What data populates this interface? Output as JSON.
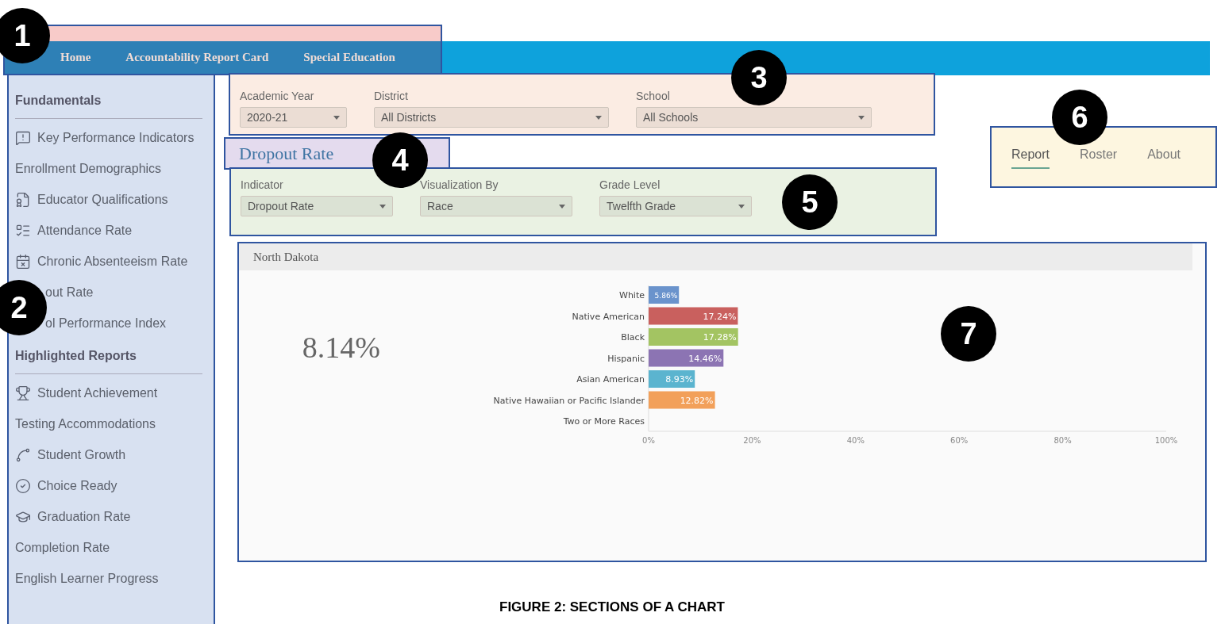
{
  "annotations": [
    {
      "label": "1"
    },
    {
      "label": "2"
    },
    {
      "label": "3"
    },
    {
      "label": "4"
    },
    {
      "label": "5"
    },
    {
      "label": "6"
    },
    {
      "label": "7"
    }
  ],
  "top_nav": {
    "items": [
      {
        "label": "Home"
      },
      {
        "label": "Accountability Report Card"
      },
      {
        "label": "Special Education"
      }
    ]
  },
  "sidebar": {
    "sections": [
      {
        "title": "Fundamentals",
        "items": [
          {
            "label": "Key Performance Indicators"
          },
          {
            "label": "Enrollment Demographics"
          },
          {
            "label": "Educator Qualifications"
          },
          {
            "label": "Attendance Rate"
          },
          {
            "label": "Chronic Absenteeism Rate"
          },
          {
            "label": "out Rate"
          },
          {
            "label": "ol Performance Index"
          }
        ]
      },
      {
        "title": "Highlighted Reports",
        "items": [
          {
            "label": "Student Achievement"
          },
          {
            "label": "Testing Accommodations"
          },
          {
            "label": "Student Growth"
          },
          {
            "label": "Choice Ready"
          },
          {
            "label": "Graduation Rate"
          },
          {
            "label": "Completion Rate"
          },
          {
            "label": "English Learner Progress"
          }
        ]
      }
    ]
  },
  "filters": [
    {
      "label": "Academic Year",
      "value": "2020-21"
    },
    {
      "label": "District",
      "value": "All Districts"
    },
    {
      "label": "School",
      "value": "All Schools"
    }
  ],
  "page_title": "Dropout Rate",
  "report_filters": [
    {
      "label": "Indicator",
      "value": "Dropout Rate"
    },
    {
      "label": "Visualization By",
      "value": "Race"
    },
    {
      "label": "Grade Level",
      "value": "Twelfth Grade"
    }
  ],
  "view_tabs": [
    {
      "label": "Report",
      "selected": true
    },
    {
      "label": "Roster",
      "selected": false
    },
    {
      "label": "About",
      "selected": false
    }
  ],
  "chart_panel": {
    "title": "North Dakota",
    "overall": "8.14%",
    "chart_data": {
      "type": "bar",
      "orientation": "horizontal",
      "series": [
        {
          "name": "White",
          "color": "#6a93cc",
          "values": [
            5.86
          ]
        },
        {
          "name": "Native American",
          "color": "#c9605e",
          "values": [
            17.24
          ]
        },
        {
          "name": "Black",
          "color": "#a3c462",
          "values": [
            17.28
          ]
        },
        {
          "name": "Hispanic",
          "color": "#8c74b3",
          "values": [
            14.46
          ]
        },
        {
          "name": "Asian American",
          "color": "#5bb4cf",
          "values": [
            8.93
          ]
        },
        {
          "name": "Native Hawaiian or Pacific Islander",
          "color": "#f2a05a",
          "values": [
            12.82
          ]
        },
        {
          "name": "Two or More Races",
          "values": [
            null
          ]
        }
      ],
      "value_labels": [
        "5.86%",
        "17.24%",
        "17.28%",
        "14.46%",
        "8.93%",
        "12.82%",
        null
      ],
      "xlim": [
        0,
        100
      ],
      "xticks": [
        {
          "value": 0,
          "label": "0%"
        },
        {
          "value": 20,
          "label": "20%"
        },
        {
          "value": 40,
          "label": "40%"
        },
        {
          "value": 60,
          "label": "60%"
        },
        {
          "value": 80,
          "label": "80%"
        },
        {
          "value": 100,
          "label": "100%"
        }
      ]
    }
  },
  "caption": "FIGURE 2: SECTIONS OF A CHART"
}
